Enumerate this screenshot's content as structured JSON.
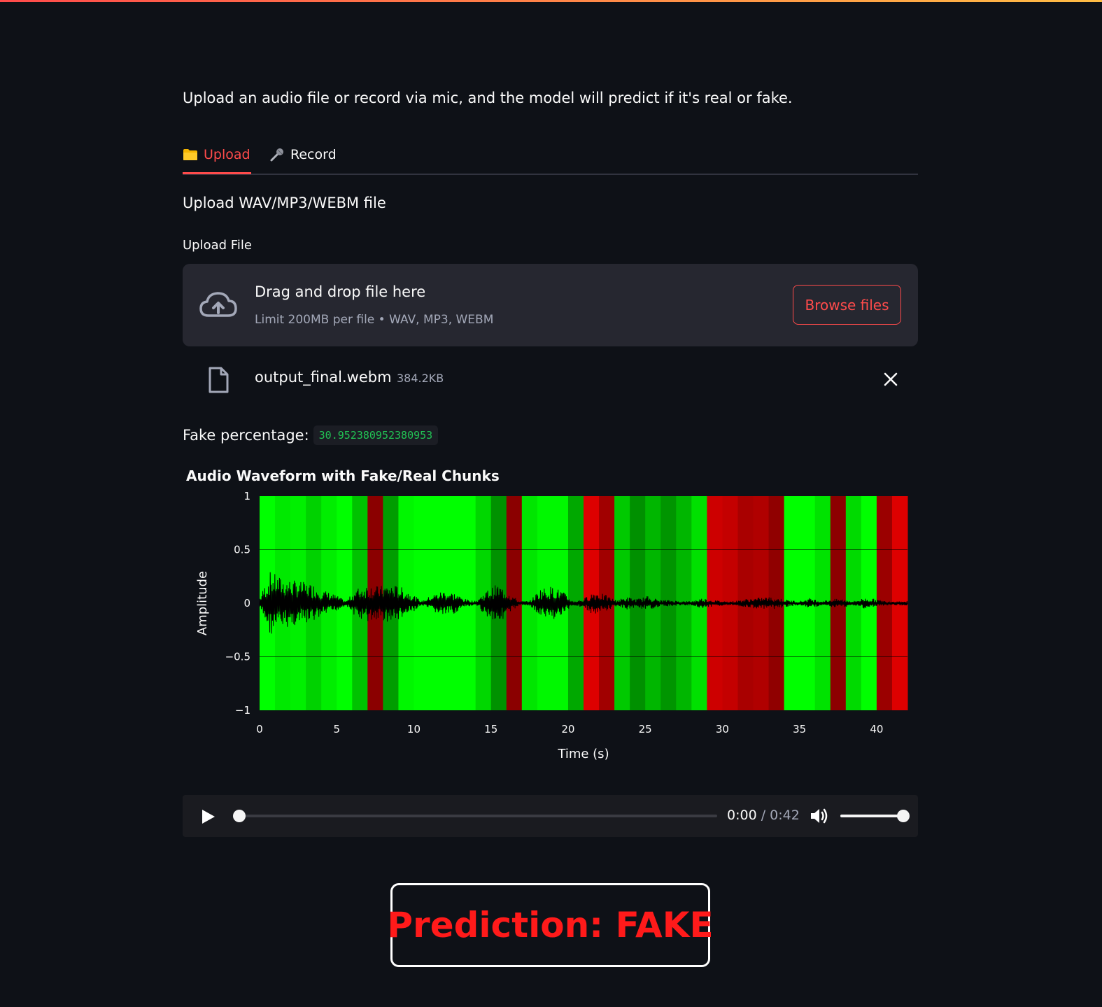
{
  "intro": "Upload an audio file or record via mic, and the model will predict if it's real or fake.",
  "tabs": [
    {
      "label": "Upload",
      "icon": "folder-icon",
      "active": true
    },
    {
      "label": "Record",
      "icon": "microphone-icon",
      "active": false
    }
  ],
  "section_title": "Upload WAV/MP3/WEBM file",
  "uploader": {
    "label": "Upload File",
    "drag_text": "Drag and drop file here",
    "limit_text": "Limit 200MB per file • WAV, MP3, WEBM",
    "browse_label": "Browse files"
  },
  "file": {
    "name": "output_final.webm",
    "size": "384.2KB"
  },
  "fake_percentage": {
    "label": "Fake percentage:",
    "value": "30.952380952380953"
  },
  "chart_data": {
    "type": "area",
    "title": "Audio Waveform with Fake/Real Chunks",
    "xlabel": "Time (s)",
    "ylabel": "Amplitude",
    "xlim": [
      0,
      42
    ],
    "ylim": [
      -1,
      1
    ],
    "x_ticks": [
      0,
      5,
      10,
      15,
      20,
      25,
      30,
      35,
      40
    ],
    "y_ticks": [
      1,
      0.5,
      0,
      -0.5,
      -1
    ],
    "y_tick_labels": [
      "1",
      "0.5",
      "0",
      "−0.5",
      "−1"
    ],
    "grid": "y",
    "chunk_seconds": 1,
    "chunk_colors": [
      "#00ff00",
      "#00e900",
      "#00f000",
      "#00d200",
      "#00ee00",
      "#00ff00",
      "#00c200",
      "#8b0000",
      "#009d00",
      "#00f700",
      "#00ff00",
      "#00ff00",
      "#00ff00",
      "#00ff00",
      "#00d700",
      "#009200",
      "#8b0000",
      "#00e600",
      "#00f800",
      "#00f800",
      "#00a800",
      "#dd0000",
      "#a10000",
      "#00c900",
      "#009000",
      "#00b600",
      "#009500",
      "#00b600",
      "#00e000",
      "#cd0000",
      "#c40000",
      "#a90000",
      "#b00000",
      "#900000",
      "#00ff00",
      "#00ff00",
      "#00e300",
      "#8d0000",
      "#00da00",
      "#00ff00",
      "#9b0000",
      "#dd0000",
      "#dd0000"
    ],
    "chunk_labels": [
      "real",
      "real",
      "real",
      "real",
      "real",
      "real",
      "real",
      "fake",
      "real",
      "real",
      "real",
      "real",
      "real",
      "real",
      "real",
      "real",
      "fake",
      "real",
      "real",
      "real",
      "real",
      "fake",
      "fake",
      "real",
      "real",
      "real",
      "real",
      "real",
      "real",
      "fake",
      "fake",
      "fake",
      "fake",
      "fake",
      "real",
      "real",
      "real",
      "fake",
      "real",
      "real",
      "fake",
      "fake",
      "fake"
    ],
    "waveform_envelope": [
      0.05,
      0.3,
      0.24,
      0.22,
      0.2,
      0.18,
      0.12,
      0.08,
      0.02,
      0.14,
      0.18,
      0.16,
      0.18,
      0.16,
      0.1,
      0.02,
      0.08,
      0.12,
      0.1,
      0.04,
      0.02,
      0.12,
      0.18,
      0.12,
      0.02,
      0.02,
      0.14,
      0.16,
      0.12,
      0.02,
      0.04,
      0.12,
      0.08,
      0.03,
      0.06,
      0.04,
      0.07,
      0.03,
      0.03,
      0.02,
      0.02,
      0.05,
      0.03,
      0.02,
      0.02,
      0.04,
      0.05,
      0.06,
      0.05,
      0.03,
      0.02,
      0.05,
      0.02,
      0.04,
      0.04,
      0.02,
      0.05,
      0.04,
      0.02,
      0.02,
      0.02
    ],
    "waveform_color": "#000000"
  },
  "audio": {
    "current": "0:00",
    "separator": "/",
    "duration": "0:42",
    "progress": 0,
    "volume": 1.0
  },
  "prediction": "Prediction: FAKE",
  "colors": {
    "accent": "#ff4b4b",
    "fake_text": "#ff1a1a",
    "background": "#0e1117",
    "code_green": "#21c354"
  }
}
